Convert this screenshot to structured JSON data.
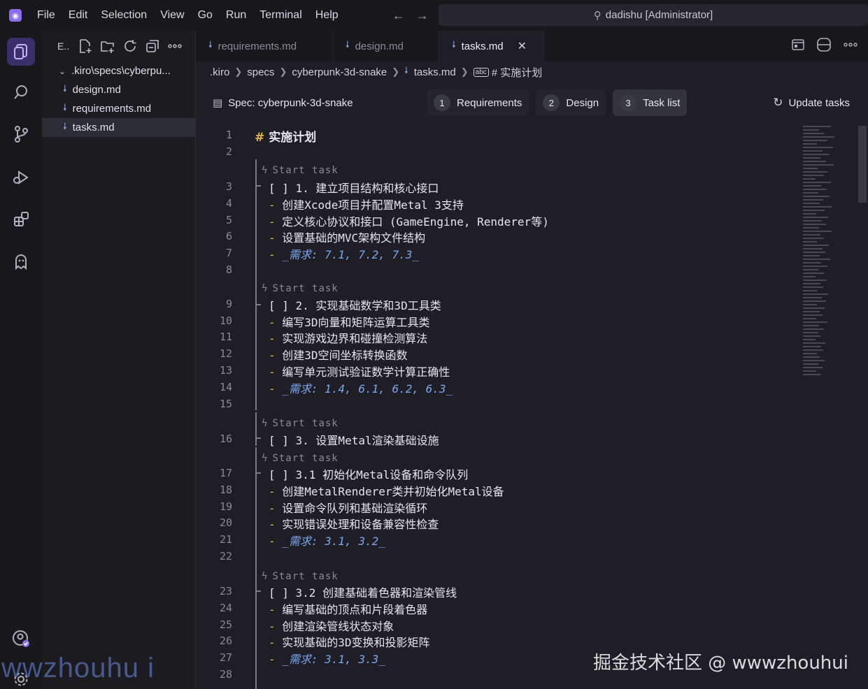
{
  "menu": [
    "File",
    "Edit",
    "Selection",
    "View",
    "Go",
    "Run",
    "Terminal",
    "Help"
  ],
  "command_center": "dadishu [Administrator]",
  "explorer": {
    "title": "E..",
    "folder": ".kiro\\specs\\cyberpu...",
    "files": [
      "design.md",
      "requirements.md",
      "tasks.md"
    ],
    "selected": "tasks.md"
  },
  "tabs": [
    {
      "label": "requirements.md",
      "active": false
    },
    {
      "label": "design.md",
      "active": false
    },
    {
      "label": "tasks.md",
      "active": true
    }
  ],
  "breadcrumb": [
    ".kiro",
    "specs",
    "cyberpunk-3d-snake",
    "tasks.md",
    "# 实施计划"
  ],
  "spec": {
    "title": "Spec: cyberpunk-3d-snake",
    "steps": [
      {
        "num": "1",
        "label": "Requirements"
      },
      {
        "num": "2",
        "label": "Design"
      },
      {
        "num": "3",
        "label": "Task list"
      }
    ],
    "active_step": 3,
    "update_label": "Update tasks"
  },
  "codelens_label": "Start task",
  "lines": [
    {
      "n": "1",
      "text": "实施计划",
      "kind": "h1"
    },
    {
      "n": "2",
      "text": ""
    },
    {
      "n": "3",
      "text": "[ ] 1. 建立项目结构和核心接口",
      "kind": "task"
    },
    {
      "n": "4",
      "text": "创建Xcode项目并配置Metal 3支持",
      "kind": "bullet"
    },
    {
      "n": "5",
      "text": "定义核心协议和接口 (GameEngine, Renderer等)",
      "kind": "bullet"
    },
    {
      "n": "6",
      "text": "设置基础的MVC架构文件结构",
      "kind": "bullet"
    },
    {
      "n": "7",
      "text": "_需求: 7.1, 7.2, 7.3_",
      "kind": "req"
    },
    {
      "n": "8",
      "text": ""
    },
    {
      "n": "9",
      "text": "[ ] 2. 实现基础数学和3D工具类",
      "kind": "task"
    },
    {
      "n": "10",
      "text": "编写3D向量和矩阵运算工具类",
      "kind": "bullet"
    },
    {
      "n": "11",
      "text": "实现游戏边界和碰撞检测算法",
      "kind": "bullet"
    },
    {
      "n": "12",
      "text": "创建3D空间坐标转换函数",
      "kind": "bullet"
    },
    {
      "n": "13",
      "text": "编写单元测试验证数学计算正确性",
      "kind": "bullet"
    },
    {
      "n": "14",
      "text": "_需求: 1.4, 6.1, 6.2, 6.3_",
      "kind": "req"
    },
    {
      "n": "15",
      "text": ""
    },
    {
      "n": "16",
      "text": "[ ] 3. 设置Metal渲染基础设施",
      "kind": "task"
    },
    {
      "n": "17",
      "text": "[ ] 3.1 初始化Metal设备和命令队列",
      "kind": "task"
    },
    {
      "n": "18",
      "text": "创建MetalRenderer类并初始化Metal设备",
      "kind": "bullet"
    },
    {
      "n": "19",
      "text": "设置命令队列和基础渲染循环",
      "kind": "bullet"
    },
    {
      "n": "20",
      "text": "实现错误处理和设备兼容性检查",
      "kind": "bullet"
    },
    {
      "n": "21",
      "text": "_需求: 3.1, 3.2_",
      "kind": "req"
    },
    {
      "n": "22",
      "text": ""
    },
    {
      "n": "23",
      "text": "[ ] 3.2 创建基础着色器和渲染管线",
      "kind": "task"
    },
    {
      "n": "24",
      "text": "编写基础的顶点和片段着色器",
      "kind": "bullet"
    },
    {
      "n": "25",
      "text": "创建渲染管线状态对象",
      "kind": "bullet"
    },
    {
      "n": "26",
      "text": "实现基础的3D变换和投影矩阵",
      "kind": "bullet"
    },
    {
      "n": "27",
      "text": "_需求: 3.1, 3.3_",
      "kind": "req"
    },
    {
      "n": "28",
      "text": ""
    }
  ],
  "watermark_left": "wwzhouhu i",
  "watermark_right": "掘金技术社区 @ wwwzhouhui",
  "colors": {
    "accent": "#8e6cf2",
    "markdown_dash": "#e6b450",
    "requirement": "#7aa6f0"
  }
}
